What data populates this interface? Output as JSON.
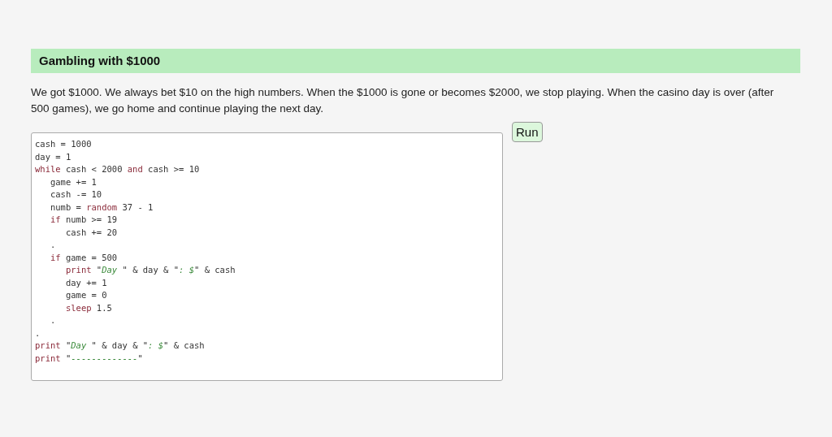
{
  "heading": "Gambling with $1000",
  "description": "We got $1000. We always bet $10 on the high numbers. When the $1000 is gone or becomes $2000, we stop playing. When the casino day is over (after 500 games), we go home and continue playing the next day.",
  "code_lines": [
    [
      {
        "kind": "text",
        "text": "cash = 1000"
      }
    ],
    [
      {
        "kind": "text",
        "text": "day = 1"
      }
    ],
    [
      {
        "kind": "keyword",
        "text": "while"
      },
      {
        "kind": "text",
        "text": " cash < 2000 "
      },
      {
        "kind": "keyword",
        "text": "and"
      },
      {
        "kind": "text",
        "text": " cash >= 10"
      }
    ],
    [
      {
        "kind": "text",
        "text": "   game += 1"
      }
    ],
    [
      {
        "kind": "text",
        "text": "   cash -= 10"
      }
    ],
    [
      {
        "kind": "text",
        "text": "   numb = "
      },
      {
        "kind": "keyword",
        "text": "random"
      },
      {
        "kind": "text",
        "text": " 37 - 1"
      }
    ],
    [
      {
        "kind": "keyword",
        "text": "   if"
      },
      {
        "kind": "text",
        "text": " numb >= 19"
      }
    ],
    [
      {
        "kind": "text",
        "text": "      cash += 20"
      }
    ],
    [
      {
        "kind": "text",
        "text": "   ."
      }
    ],
    [
      {
        "kind": "keyword",
        "text": "   if"
      },
      {
        "kind": "text",
        "text": " game = 500"
      }
    ],
    [
      {
        "kind": "keyword",
        "text": "      print"
      },
      {
        "kind": "text",
        "text": " \""
      },
      {
        "kind": "string",
        "text": "Day "
      },
      {
        "kind": "text",
        "text": "\" & day & \""
      },
      {
        "kind": "string",
        "text": ": $"
      },
      {
        "kind": "text",
        "text": "\" & cash"
      }
    ],
    [
      {
        "kind": "text",
        "text": "      day += 1"
      }
    ],
    [
      {
        "kind": "text",
        "text": "      game = 0"
      }
    ],
    [
      {
        "kind": "keyword",
        "text": "      sleep"
      },
      {
        "kind": "text",
        "text": " 1.5"
      }
    ],
    [
      {
        "kind": "text",
        "text": "   ."
      }
    ],
    [
      {
        "kind": "text",
        "text": "."
      }
    ],
    [
      {
        "kind": "keyword",
        "text": "print"
      },
      {
        "kind": "text",
        "text": " \""
      },
      {
        "kind": "string",
        "text": "Day "
      },
      {
        "kind": "text",
        "text": "\" & day & \""
      },
      {
        "kind": "string",
        "text": ": $"
      },
      {
        "kind": "text",
        "text": "\" & cash"
      }
    ],
    [
      {
        "kind": "keyword",
        "text": "print"
      },
      {
        "kind": "text",
        "text": " \""
      },
      {
        "kind": "string",
        "text": "-------------"
      },
      {
        "kind": "text",
        "text": "\""
      }
    ]
  ],
  "run_button": "Run"
}
